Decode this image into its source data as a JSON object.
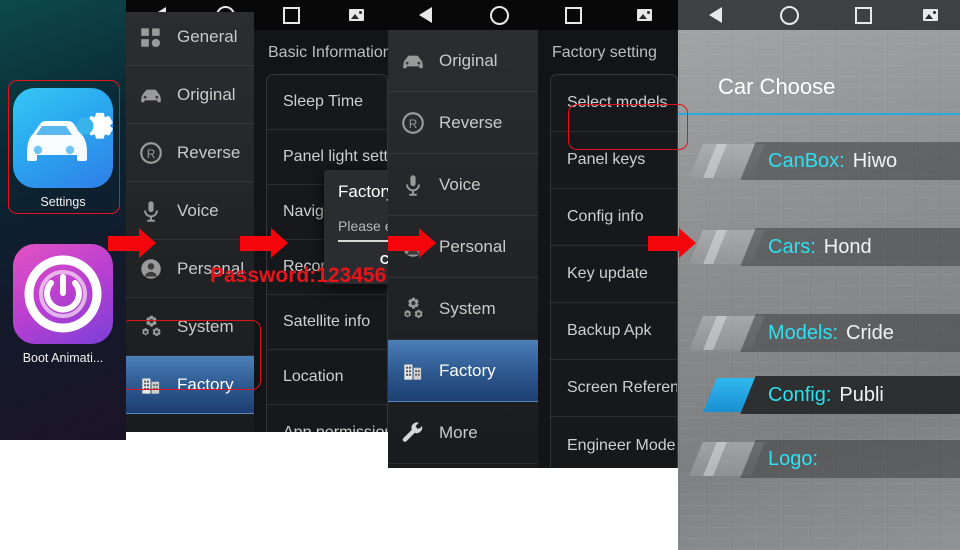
{
  "navbar": {
    "icons": [
      "back-icon",
      "home-icon",
      "recents-icon",
      "screenshot-icon"
    ]
  },
  "annotation": {
    "password_note": "Password:123456",
    "arrow_color": "#f4040b",
    "highlight_color": "#e0141e"
  },
  "panel1": {
    "name": "launcher",
    "apps": [
      {
        "label": "Settings",
        "icon": "car-settings-icon",
        "highlighted": true
      },
      {
        "label": "Boot Animati...",
        "icon": "power-ring-icon",
        "highlighted": false
      }
    ]
  },
  "panel2": {
    "name": "settings-basic-information",
    "sidebar": [
      {
        "label": "General",
        "icon": "grid-icon",
        "selected": false
      },
      {
        "label": "Original",
        "icon": "car-icon",
        "selected": false
      },
      {
        "label": "Reverse",
        "icon": "reverse-r-icon",
        "selected": false
      },
      {
        "label": "Voice",
        "icon": "microphone-icon",
        "selected": false
      },
      {
        "label": "Personal",
        "icon": "person-icon",
        "selected": false
      },
      {
        "label": "System",
        "icon": "gears-icon",
        "selected": false
      },
      {
        "label": "Factory",
        "icon": "building-icon",
        "selected": true
      }
    ],
    "content_title": "Basic Information",
    "content_rows": [
      "Sleep Time",
      "Panel light setting",
      "Navigation",
      "Record",
      "Satellite info",
      "Location",
      "App permissions"
    ],
    "dialog": {
      "title": "Factory",
      "prompt": "Please en",
      "cancel_label": "CANCEL"
    }
  },
  "panel3": {
    "name": "factory-setting",
    "sidebar": [
      {
        "label": "Original",
        "icon": "car-icon",
        "selected": false
      },
      {
        "label": "Reverse",
        "icon": "reverse-r-icon",
        "selected": false
      },
      {
        "label": "Voice",
        "icon": "microphone-icon",
        "selected": false
      },
      {
        "label": "Personal",
        "icon": "person-icon",
        "selected": false
      },
      {
        "label": "System",
        "icon": "gears-icon",
        "selected": false
      },
      {
        "label": "Factory",
        "icon": "building-icon",
        "selected": true
      },
      {
        "label": "More",
        "icon": "wrench-icon",
        "selected": false
      }
    ],
    "content_title": "Factory setting",
    "content_rows": [
      {
        "label": "Select models",
        "highlighted": true
      },
      {
        "label": "Panel keys",
        "highlighted": false
      },
      {
        "label": "Config info",
        "highlighted": false
      },
      {
        "label": "Key update",
        "highlighted": false
      },
      {
        "label": "Backup Apk",
        "highlighted": false
      },
      {
        "label": "Screen Reference",
        "highlighted": false
      },
      {
        "label": "Engineer Mode",
        "highlighted": false
      }
    ]
  },
  "panel4": {
    "name": "car-choose",
    "title": "Car Choose",
    "accent": "#2aa9e0",
    "key_color": "#2ee0f2",
    "rows": [
      {
        "key": "CanBox:",
        "value": "Hiwo",
        "active": false
      },
      {
        "key": "Cars:",
        "value": "Hond",
        "active": false
      },
      {
        "key": "Models:",
        "value": "Cride",
        "active": false
      },
      {
        "key": "Config:",
        "value": "Publi",
        "active": true
      },
      {
        "key": "Logo:",
        "value": "",
        "active": false
      }
    ]
  }
}
